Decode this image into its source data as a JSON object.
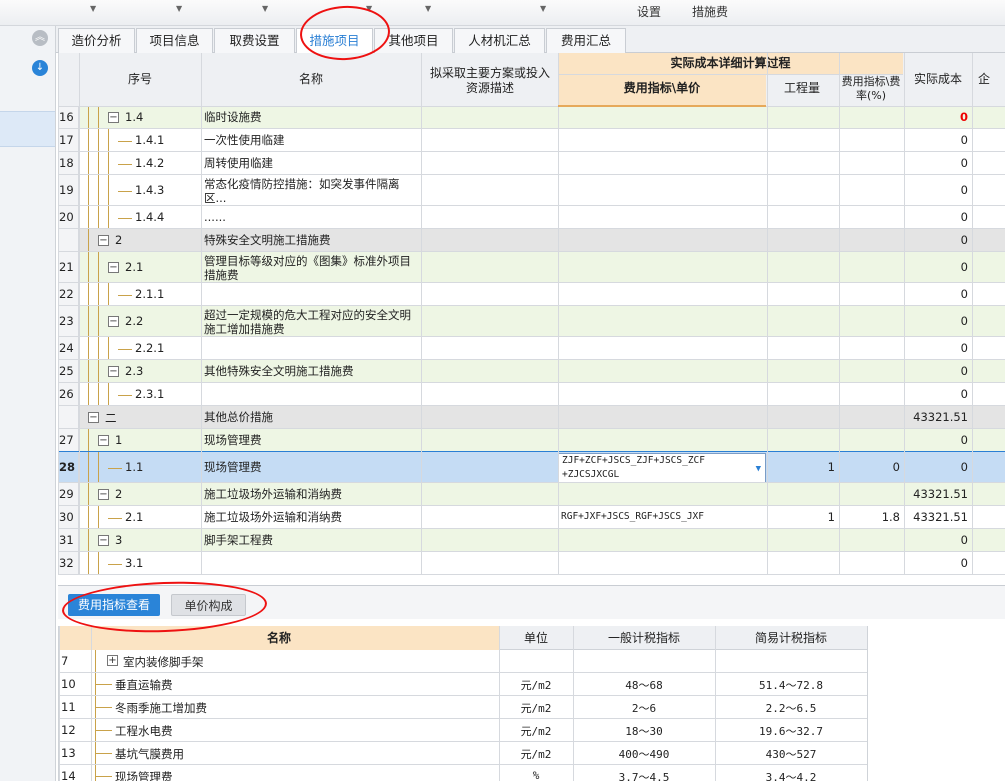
{
  "toolbar": {
    "item1": "设置",
    "item2": "措施费"
  },
  "tabs": [
    {
      "label": "造价分析"
    },
    {
      "label": "项目信息"
    },
    {
      "label": "取费设置"
    },
    {
      "label": "措施项目"
    },
    {
      "label": "其他项目"
    },
    {
      "label": "人材机汇总"
    },
    {
      "label": "费用汇总"
    }
  ],
  "grid": {
    "headers": {
      "seq": "序号",
      "name": "名称",
      "desc": "拟采取主要方案或投入资源描述",
      "group": "实际成本详细计算过程",
      "formula": "费用指标\\单价",
      "qty": "工程量",
      "rate": "费用指标\\费率(%)",
      "cost": "实际成本",
      "extra": "企"
    },
    "rows": [
      {
        "num": "16",
        "code": "1.4",
        "name": "临时设施费",
        "formula": "",
        "qty": "",
        "rate": "",
        "cost": "0",
        "level": 2,
        "expand": "minus",
        "color": "green",
        "cost_red": true
      },
      {
        "num": "17",
        "code": "1.4.1",
        "name": "一次性使用临建",
        "formula": "",
        "qty": "",
        "rate": "",
        "cost": "0",
        "level": 3,
        "expand": "",
        "color": "white"
      },
      {
        "num": "18",
        "code": "1.4.2",
        "name": "周转使用临建",
        "formula": "",
        "qty": "",
        "rate": "",
        "cost": "0",
        "level": 3,
        "expand": "",
        "color": "white"
      },
      {
        "num": "19",
        "code": "1.4.3",
        "name": "常态化疫情防控措施：如突发事件隔离",
        "name2": "区...",
        "formula": "",
        "qty": "",
        "rate": "",
        "cost": "0",
        "level": 3,
        "expand": "",
        "color": "white"
      },
      {
        "num": "20",
        "code": "1.4.4",
        "name": "......",
        "formula": "",
        "qty": "",
        "rate": "",
        "cost": "0",
        "level": 3,
        "expand": "",
        "color": "white"
      },
      {
        "num": "",
        "code": "2",
        "name": "特殊安全文明施工措施费",
        "formula": "",
        "qty": "",
        "rate": "",
        "cost": "0",
        "level": 1,
        "expand": "minus",
        "color": "gray"
      },
      {
        "num": "21",
        "code": "2.1",
        "name": "管理目标等级对应的《图集》标准外项目",
        "name2": "措施费",
        "formula": "",
        "qty": "",
        "rate": "",
        "cost": "0",
        "level": 2,
        "expand": "minus",
        "color": "green"
      },
      {
        "num": "22",
        "code": "2.1.1",
        "name": "",
        "formula": "",
        "qty": "",
        "rate": "",
        "cost": "0",
        "level": 3,
        "expand": "",
        "color": "white"
      },
      {
        "num": "23",
        "code": "2.2",
        "name": "超过一定规模的危大工程对应的安全文明",
        "name2": "施工增加措施费",
        "formula": "",
        "qty": "",
        "rate": "",
        "cost": "0",
        "level": 2,
        "expand": "minus",
        "color": "green"
      },
      {
        "num": "24",
        "code": "2.2.1",
        "name": "",
        "formula": "",
        "qty": "",
        "rate": "",
        "cost": "0",
        "level": 3,
        "expand": "",
        "color": "white"
      },
      {
        "num": "25",
        "code": "2.3",
        "name": "其他特殊安全文明施工措施费",
        "formula": "",
        "qty": "",
        "rate": "",
        "cost": "0",
        "level": 2,
        "expand": "minus",
        "color": "green"
      },
      {
        "num": "26",
        "code": "2.3.1",
        "name": "",
        "formula": "",
        "qty": "",
        "rate": "",
        "cost": "0",
        "level": 3,
        "expand": "",
        "color": "white"
      },
      {
        "num": "",
        "code": "二",
        "name": "其他总价措施",
        "formula": "",
        "qty": "",
        "rate": "",
        "cost": "43321.51",
        "level": 0,
        "expand": "minus",
        "color": "gray"
      },
      {
        "num": "27",
        "code": "1",
        "name": "现场管理费",
        "formula": "",
        "qty": "",
        "rate": "",
        "cost": "0",
        "level": 1,
        "expand": "minus",
        "color": "green"
      },
      {
        "num": "28",
        "code": "1.1",
        "name": "现场管理费",
        "formula": "ZJF+ZCF+JSCS_ZJF+JSCS_ZCF",
        "formula2": "+ZJCSJXCGL",
        "qty": "1",
        "rate": "0",
        "cost": "0",
        "level": 2,
        "expand": "",
        "color": "selected"
      },
      {
        "num": "29",
        "code": "2",
        "name": "施工垃圾场外运输和消纳费",
        "formula": "",
        "qty": "",
        "rate": "",
        "cost": "43321.51",
        "level": 1,
        "expand": "minus",
        "color": "green"
      },
      {
        "num": "30",
        "code": "2.1",
        "name": "施工垃圾场外运输和消纳费",
        "formula": "RGF+JXF+JSCS_RGF+JSCS_JXF",
        "qty": "1",
        "rate": "1.8",
        "cost": "43321.51",
        "level": 2,
        "expand": "",
        "color": "white"
      },
      {
        "num": "31",
        "code": "3",
        "name": "脚手架工程费",
        "formula": "",
        "qty": "",
        "rate": "",
        "cost": "0",
        "level": 1,
        "expand": "minus",
        "color": "green"
      },
      {
        "num": "32",
        "code": "3.1",
        "name": "",
        "formula": "",
        "qty": "",
        "rate": "",
        "cost": "0",
        "level": 2,
        "expand": "",
        "color": "white"
      }
    ]
  },
  "lower": {
    "tabs": [
      {
        "label": "费用指标查看"
      },
      {
        "label": "单价构成"
      }
    ],
    "headers": {
      "name": "名称",
      "unit": "单位",
      "general": "一般计税指标",
      "simple": "简易计税指标"
    },
    "rows": [
      {
        "num": "7",
        "name": "室内装修脚手架",
        "unit": "",
        "general": "",
        "simple": "",
        "expand": "plus"
      },
      {
        "num": "10",
        "name": "垂直运输费",
        "unit": "元/m2",
        "general": "48～68",
        "simple": "51.4～72.8",
        "expand": ""
      },
      {
        "num": "11",
        "name": "冬雨季施工增加费",
        "unit": "元/m2",
        "general": "2～6",
        "simple": "2.2～6.5",
        "expand": ""
      },
      {
        "num": "12",
        "name": "工程水电费",
        "unit": "元/m2",
        "general": "18～30",
        "simple": "19.6～32.7",
        "expand": ""
      },
      {
        "num": "13",
        "name": "基坑气膜费用",
        "unit": "元/m2",
        "general": "400～490",
        "simple": "430～527",
        "expand": ""
      },
      {
        "num": "14",
        "name": "现场管理费",
        "unit": "%",
        "general": "3.7～4.5",
        "simple": "3.4～4.2",
        "expand": ""
      }
    ]
  },
  "colors": {
    "accent": "#2a7fd4",
    "annotation": "#e11111",
    "row_green": "#eef6e4",
    "row_gray": "#e4e4e4",
    "row_selected": "#c5dcf4",
    "header_orange": "#fbe4c4"
  }
}
